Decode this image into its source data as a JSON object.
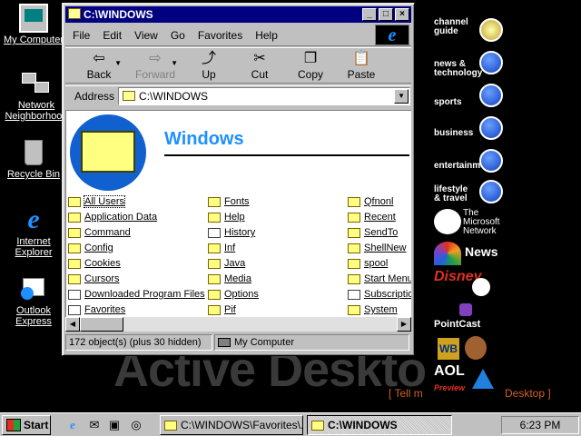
{
  "desktop": {
    "icons": [
      {
        "label": "My Computer"
      },
      {
        "label": "Network Neighborhood"
      },
      {
        "label": "Recycle Bin"
      },
      {
        "label": "Internet Explorer"
      },
      {
        "label": "Outlook Express"
      }
    ],
    "wallpaper_text": "Active Deskto",
    "wallpaper_link_left": "[ Tell m",
    "wallpaper_link_right": "Desktop ]"
  },
  "channel_bar": [
    {
      "label": "channel guide"
    },
    {
      "label": "news & technology"
    },
    {
      "label": "sports"
    },
    {
      "label": "business"
    },
    {
      "label": "entertainment"
    },
    {
      "label": "lifestyle & travel"
    },
    {
      "label": "The Microsoft Network"
    },
    {
      "label": "News"
    },
    {
      "label": "Disney"
    },
    {
      "label": "PointCast"
    },
    {
      "label": "WB"
    },
    {
      "label": "AOL"
    },
    {
      "label": "Preview"
    }
  ],
  "window": {
    "title": "C:\\WINDOWS",
    "menu": [
      "File",
      "Edit",
      "View",
      "Go",
      "Favorites",
      "Help"
    ],
    "toolbar": {
      "back": "Back",
      "forward": "Forward",
      "up": "Up",
      "cut": "Cut",
      "copy": "Copy",
      "paste": "Paste"
    },
    "address_label": "Address",
    "address_value": "C:\\WINDOWS",
    "heading": "Windows",
    "files": {
      "col1": [
        "All Users",
        "Application Data",
        "Command",
        "Config",
        "Cookies",
        "Cursors",
        "Downloaded Program Files",
        "Favorites"
      ],
      "col2": [
        "Fonts",
        "Help",
        "History",
        "Inf",
        "Java",
        "Media",
        "Options",
        "Pif"
      ],
      "col3": [
        "Qfnonl",
        "Recent",
        "SendTo",
        "ShellNew",
        "spool",
        "Start Menu",
        "Subscriptio",
        "System"
      ]
    },
    "status_left": "172 object(s) (plus 30 hidden)",
    "status_right": "My Computer"
  },
  "taskbar": {
    "start": "Start",
    "task1": "C:\\WINDOWS\\Favorites\\...",
    "task2": "C:\\WINDOWS",
    "clock": "6:23 PM"
  }
}
